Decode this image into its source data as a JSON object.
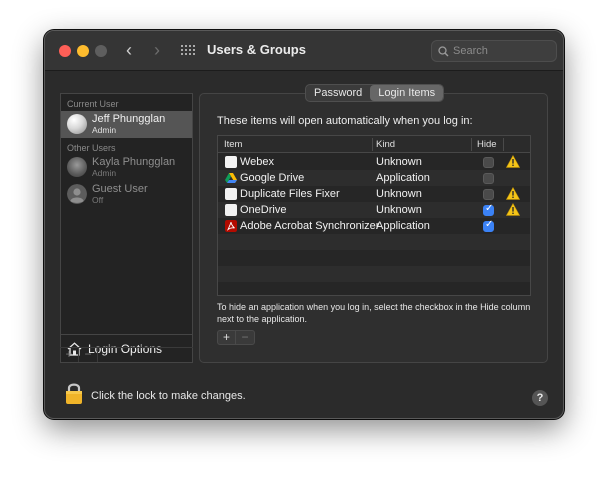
{
  "window": {
    "title": "Users & Groups"
  },
  "search": {
    "placeholder": "Search"
  },
  "sidebar": {
    "current_user_label": "Current User",
    "other_users_label": "Other Users",
    "users": [
      {
        "name": "Jeff Phungglan",
        "role": "Admin",
        "selected": true
      },
      {
        "name": "Kayla Phungglan",
        "role": "Admin",
        "selected": false
      },
      {
        "name": "Guest User",
        "role": "Off",
        "selected": false
      }
    ],
    "login_options_label": "Login Options",
    "add_label": "+",
    "remove_label": "−"
  },
  "tabs": [
    {
      "label": "Password",
      "active": false
    },
    {
      "label": "Login Items",
      "active": true
    }
  ],
  "login_items": {
    "intro": "These items will open automatically when you log in:",
    "columns": {
      "item": "Item",
      "kind": "Kind",
      "hide": "Hide"
    },
    "rows": [
      {
        "name": "Webex",
        "kind": "Unknown",
        "hide": false,
        "warning": true,
        "icon": "generic-app-icon"
      },
      {
        "name": "Google Drive",
        "kind": "Application",
        "hide": false,
        "warning": false,
        "icon": "google-drive-icon"
      },
      {
        "name": "Duplicate Files Fixer",
        "kind": "Unknown",
        "hide": false,
        "warning": true,
        "icon": "generic-app-icon"
      },
      {
        "name": "OneDrive",
        "kind": "Unknown",
        "hide": true,
        "warning": true,
        "icon": "generic-app-icon"
      },
      {
        "name": "Adobe Acrobat Synchronizer",
        "kind": "Application",
        "hide": true,
        "warning": false,
        "icon": "acrobat-icon"
      }
    ],
    "note": "To hide an application when you log in, select the checkbox in the Hide column next to the application.",
    "add_label": "+",
    "remove_label": "−"
  },
  "footer": {
    "lock_text": "Click the lock to make changes.",
    "help_label": "?"
  },
  "colors": {
    "accent": "#3b82f6",
    "warning": "#f5c518",
    "close": "#fe5f57",
    "minimize": "#febc2e"
  }
}
